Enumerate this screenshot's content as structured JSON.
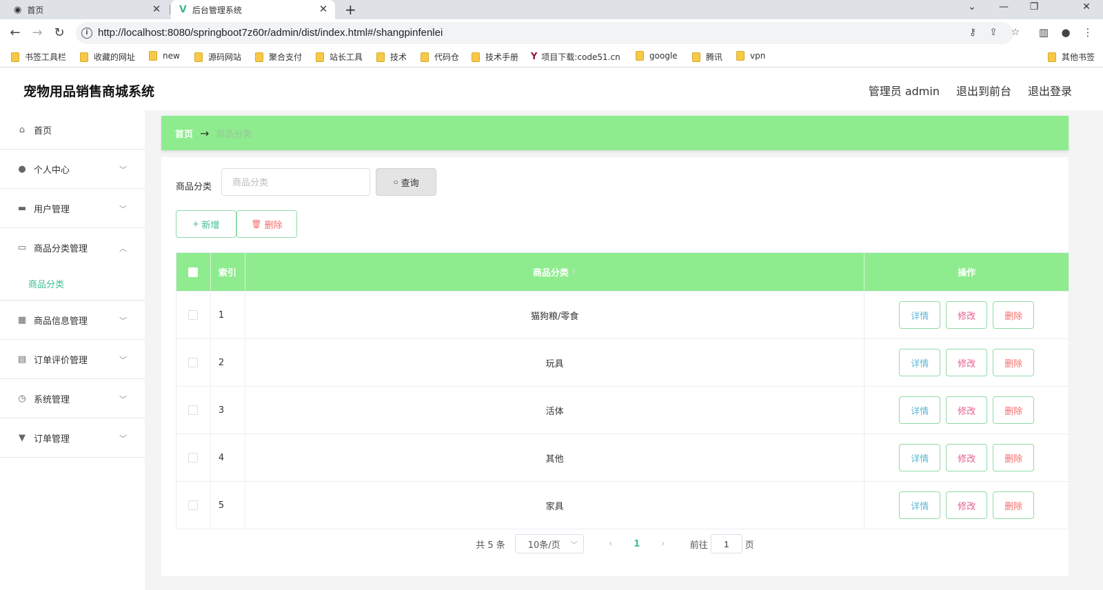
{
  "browser": {
    "tabs": [
      {
        "title": "首页",
        "icon": "globe-icon"
      },
      {
        "title": "后台管理系统",
        "icon": "vue-icon"
      }
    ],
    "url": "http://localhost:8080/springboot7z60r/admin/dist/index.html#/shangpinfenlei",
    "bookmarks": [
      "书签工具栏",
      "收藏的网址",
      "new",
      "源码网站",
      "聚合支付",
      "站长工具",
      "技术",
      "代码仓",
      "技术手册",
      "项目下载:code51.cn",
      "google",
      "腾讯",
      "vpn"
    ],
    "other_bookmarks": "其他书签"
  },
  "header": {
    "title": "宠物用品销售商城系统",
    "user_label": "管理员 admin",
    "to_front_label": "退出到前台",
    "logout_label": "退出登录"
  },
  "sidebar": {
    "items": [
      {
        "label": "首页",
        "icon": "home-icon"
      },
      {
        "label": "个人中心",
        "icon": "user-icon"
      },
      {
        "label": "用户管理",
        "icon": "briefcase-icon"
      },
      {
        "label": "商品分类管理",
        "icon": "monitor-icon",
        "expanded": true,
        "children": [
          "商品分类"
        ]
      },
      {
        "label": "商品信息管理",
        "icon": "grid-icon"
      },
      {
        "label": "订单评价管理",
        "icon": "clipboard-icon"
      },
      {
        "label": "系统管理",
        "icon": "clock-icon"
      },
      {
        "label": "订单管理",
        "icon": "stamp-icon"
      }
    ]
  },
  "breadcrumb": {
    "home": "首页",
    "arrow": "→",
    "current": "商品分类"
  },
  "search": {
    "label": "商品分类",
    "placeholder": "商品分类",
    "button_label": "查询"
  },
  "actions": {
    "add_label": "新增",
    "delete_label": "删除"
  },
  "table": {
    "headers": {
      "index": "索引",
      "category": "商品分类",
      "operations": "操作"
    },
    "rows": [
      {
        "index": "1",
        "category": "猫狗粮/零食"
      },
      {
        "index": "2",
        "category": "玩具"
      },
      {
        "index": "3",
        "category": "活体"
      },
      {
        "index": "4",
        "category": "其他"
      },
      {
        "index": "5",
        "category": "家具"
      }
    ],
    "row_actions": {
      "detail": "详情",
      "edit": "修改",
      "delete": "删除"
    }
  },
  "pagination": {
    "total_text": "共 5 条",
    "page_size": "10条/页",
    "current_page": "1",
    "goto_prefix": "前往",
    "goto_value": "1",
    "goto_suffix": "页"
  },
  "colors": {
    "accent": "#8eec8e",
    "link": "#3fbf8f",
    "danger": "#f56c6c"
  }
}
